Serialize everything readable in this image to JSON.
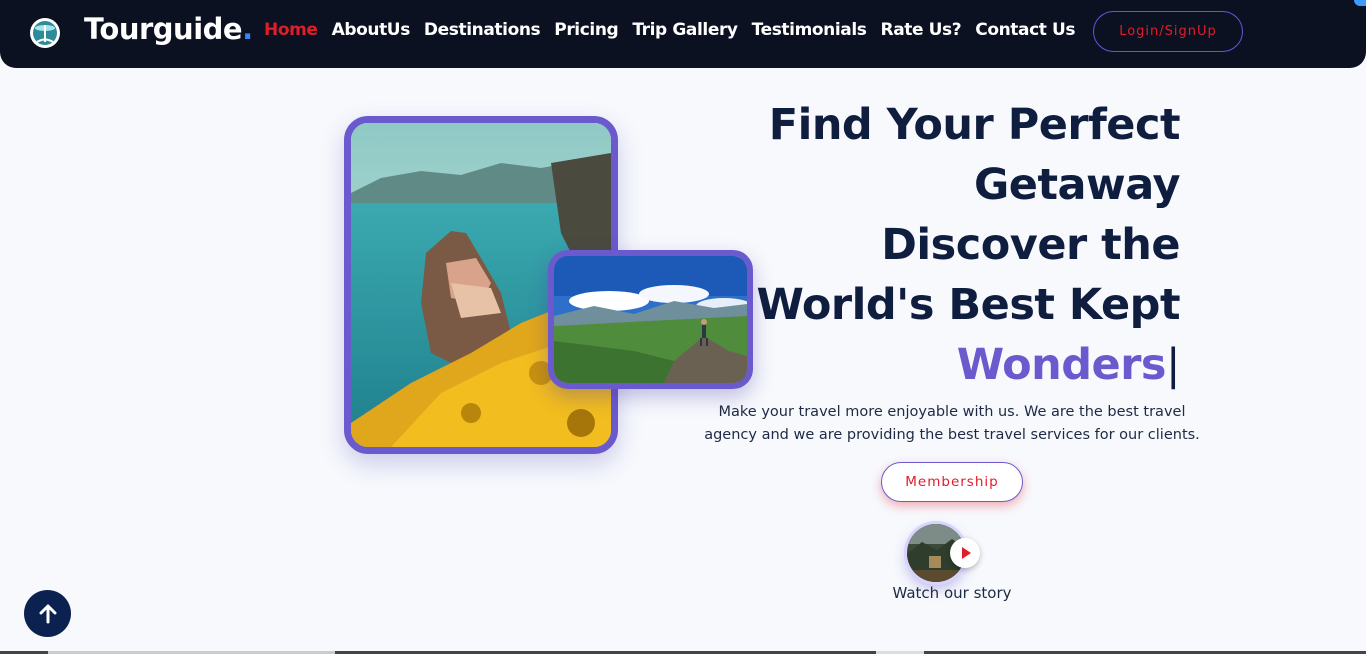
{
  "navbar": {
    "brand": "Tourguide",
    "brand_dot": ".",
    "links": [
      "Home",
      "AboutUs",
      "Destinations",
      "Pricing",
      "Trip Gallery",
      "Testimonials",
      "Rate Us?",
      "Contact Us"
    ],
    "active_link": "Home",
    "login_label": "Login/SignUp"
  },
  "hero": {
    "headline_lines": [
      "Find Your Perfect",
      "Getaway",
      "Discover the",
      "World's Best Kept"
    ],
    "headline_accent": "Wonders",
    "caret": "|",
    "description": "Make your travel more enjoyable with us. We are the best travel agency and we are providing the best travel services for our clients.",
    "membership_label": "Membership",
    "story_label": "Watch our story"
  },
  "colors": {
    "navbar_bg": "#0b1120",
    "accent_purple": "#6a5acd",
    "accent_red": "#e11d2a",
    "heading_navy": "#0f1d3f",
    "page_bg": "#f7f9fd"
  },
  "icons": {
    "logo": "globe-logo-icon",
    "play": "play-icon",
    "scroll_top": "arrow-up-icon"
  }
}
